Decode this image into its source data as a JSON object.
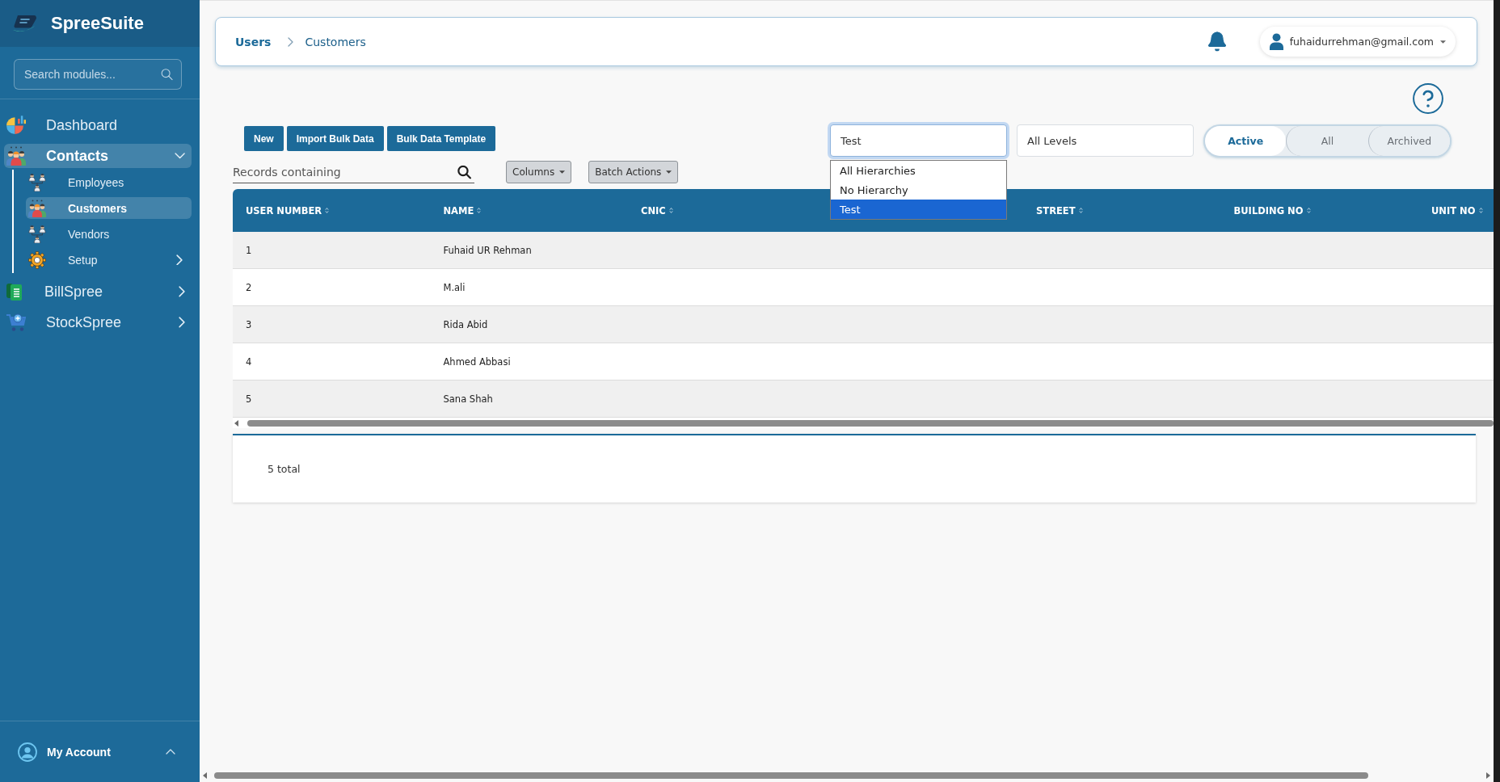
{
  "sidebar": {
    "brand": "SpreeSuite",
    "search": {
      "placeholder": "Search modules..."
    },
    "items": [
      {
        "kind": "link",
        "label": "Dashboard",
        "selected": false
      },
      {
        "kind": "group",
        "label": "Contacts",
        "selected": true,
        "expanded": true,
        "children": [
          {
            "kind": "link",
            "label": "Employees",
            "selected": false
          },
          {
            "kind": "link",
            "label": "Customers",
            "selected": true
          },
          {
            "kind": "link",
            "label": "Vendors",
            "selected": false
          },
          {
            "kind": "group",
            "label": "Setup",
            "selected": false,
            "expanded": false
          }
        ]
      },
      {
        "kind": "group",
        "label": "BillSpree",
        "selected": false,
        "expanded": false
      },
      {
        "kind": "group",
        "label": "StockSpree",
        "selected": false,
        "expanded": false
      }
    ],
    "account": {
      "label": "My Account",
      "expanded": false
    }
  },
  "header": {
    "breadcrumb": [
      {
        "label": "Users"
      },
      {
        "label": "Customers"
      }
    ],
    "user": {
      "email": "fuhaidurrehman@gmail.com"
    }
  },
  "toolbar": {
    "buttons": [
      {
        "label": "New"
      },
      {
        "label": "Import Bulk Data"
      },
      {
        "label": "Bulk Data Template"
      }
    ],
    "search": {
      "placeholder": "Records containing"
    },
    "menus": [
      {
        "label": "Columns"
      },
      {
        "label": "Batch Actions"
      }
    ]
  },
  "filters": {
    "hierarchy": {
      "value": "Test",
      "expanded": true,
      "options": [
        {
          "label": "All Hierarchies",
          "selected": false
        },
        {
          "label": "No Hierarchy",
          "selected": false
        },
        {
          "label": "Test",
          "selected": true
        }
      ]
    },
    "level": {
      "value": "All Levels"
    },
    "status_tabs": [
      {
        "label": "Active",
        "selected": true
      },
      {
        "label": "All",
        "selected": false
      },
      {
        "label": "Archived",
        "selected": false
      }
    ]
  },
  "table": {
    "columns": [
      {
        "kind": "sortable",
        "label": "USER NUMBER"
      },
      {
        "kind": "sortable",
        "label": "NAME"
      },
      {
        "kind": "sortable",
        "label": "CNIC"
      },
      {
        "kind": "covered"
      },
      {
        "kind": "sortable",
        "label": "STREET"
      },
      {
        "kind": "sortable",
        "label": "BUILDING NO"
      },
      {
        "kind": "sortable",
        "label": "UNIT NO"
      }
    ],
    "rows": [
      {
        "cells": [
          "1",
          "Fuhaid UR Rehman"
        ]
      },
      {
        "cells": [
          "2",
          "M.ali"
        ]
      },
      {
        "cells": [
          "3",
          "Rida Abid"
        ]
      },
      {
        "cells": [
          "4",
          "Ahmed Abbasi"
        ]
      },
      {
        "cells": [
          "5",
          "Sana Shah"
        ]
      }
    ]
  },
  "footer": {
    "total": "5 total"
  }
}
